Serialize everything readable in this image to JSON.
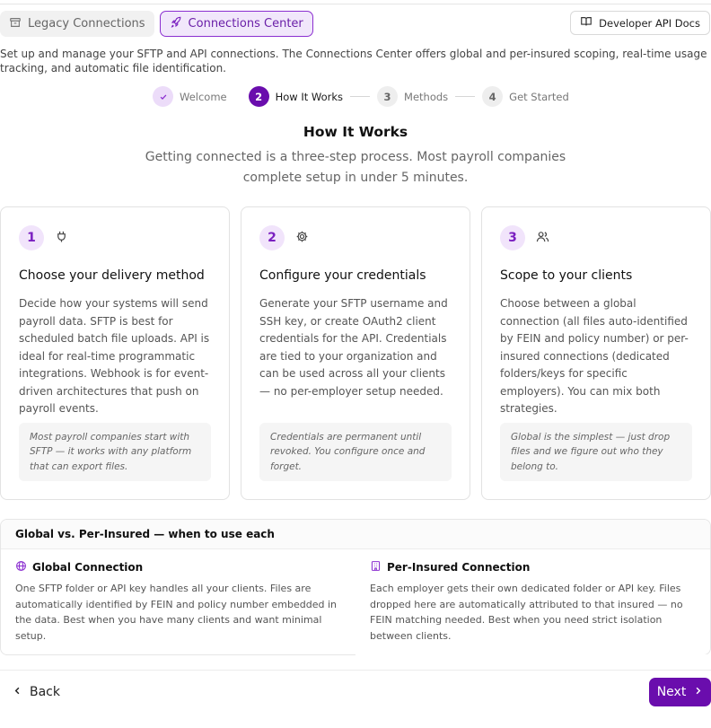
{
  "tabs": [
    {
      "label": "Legacy Connections",
      "icon": "archive-icon",
      "active": false
    },
    {
      "label": "Connections Center",
      "icon": "rocket-icon",
      "active": true
    }
  ],
  "header": {
    "api_docs_label": "Developer API Docs",
    "api_docs_icon": "book-open-icon"
  },
  "intro": "Set up and manage your SFTP and API connections. The Connections Center offers global and per-insured scoping, real-time usage tracking, and automatic file identification.",
  "stepper": {
    "steps": [
      {
        "number": "",
        "label": "Welcome",
        "state": "done"
      },
      {
        "number": "2",
        "label": "How It Works",
        "state": "current"
      },
      {
        "number": "3",
        "label": "Methods",
        "state": "future"
      },
      {
        "number": "4",
        "label": "Get Started",
        "state": "future"
      }
    ]
  },
  "section": {
    "title": "How It Works",
    "subtitle": "Getting connected is a three-step process. Most payroll companies complete setup in under 5 minutes."
  },
  "cards": [
    {
      "number": "1",
      "icon": "plug-icon",
      "title": "Choose your delivery method",
      "body": "Decide how your systems will send payroll data. SFTP is best for scheduled batch file uploads. API is ideal for real-time programmatic integrations. Webhook is for event-driven architectures that push on payroll events.",
      "note": "Most payroll companies start with SFTP — it works with any platform that can export files."
    },
    {
      "number": "2",
      "icon": "gear-icon",
      "title": "Configure your credentials",
      "body": "Generate your SFTP username and SSH key, or create OAuth2 client credentials for the API. Credentials are tied to your organization and can be used across all your clients — no per-employer setup needed.",
      "note": "Credentials are permanent until revoked. You configure once and forget."
    },
    {
      "number": "3",
      "icon": "users-icon",
      "title": "Scope to your clients",
      "body": "Choose between a global connection (all files auto-identified by FEIN and policy number) or per-insured connections (dedicated folders/keys for specific employers). You can mix both strategies.",
      "note": "Global is the simplest — just drop files and we figure out who they belong to."
    }
  ],
  "compare": {
    "title": "Global vs. Per-Insured — when to use each",
    "global": {
      "icon": "globe-icon",
      "title": "Global Connection",
      "body": "One SFTP folder or API key handles all your clients. Files are automatically identified by FEIN and policy number embedded in the data. Best when you have many clients and want minimal setup."
    },
    "per_insured": {
      "icon": "building-icon",
      "title": "Per-Insured Connection",
      "body": "Each employer gets their own dedicated folder or API key. Files dropped here are automatically attributed to that insured — no FEIN matching needed. Best when you need strict isolation between clients."
    }
  },
  "footer": {
    "back_label": "Back",
    "next_label": "Next"
  },
  "colors": {
    "accent": "#6a0dad",
    "accent_light": "#f1e4fb"
  }
}
